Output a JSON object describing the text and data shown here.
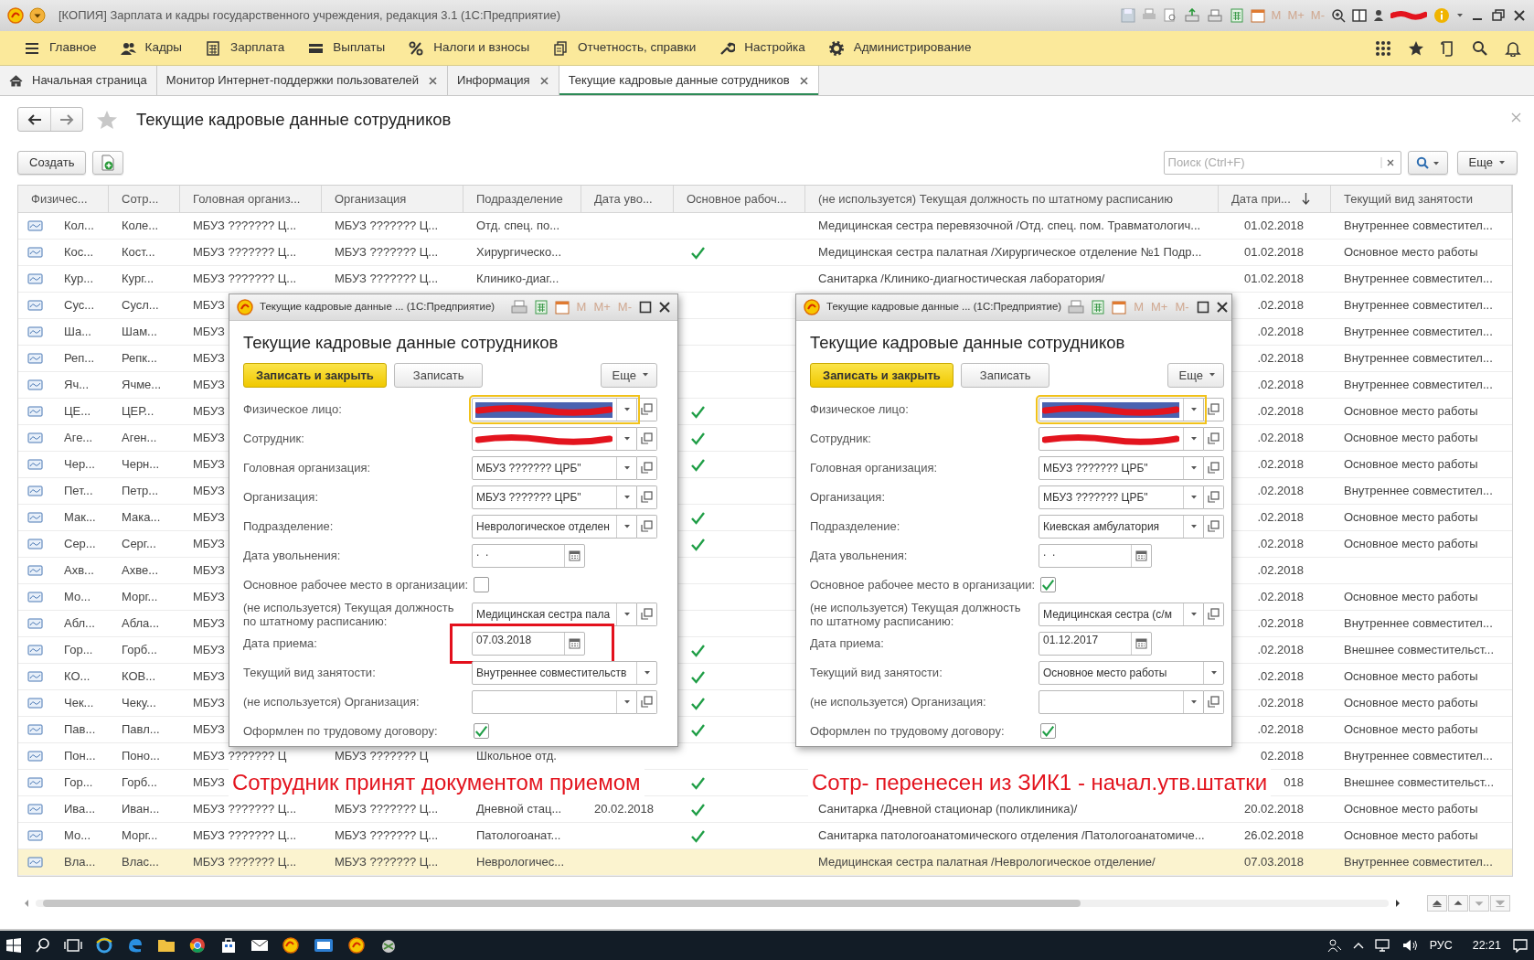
{
  "window": {
    "title": "[КОПИЯ] Зарплата и кадры государственного учреждения, редакция 3.1  (1С:Предприятие)",
    "memory_buttons": [
      "M",
      "M+",
      "M-"
    ]
  },
  "menu": [
    {
      "label": "Главное"
    },
    {
      "label": "Кадры"
    },
    {
      "label": "Зарплата"
    },
    {
      "label": "Выплаты"
    },
    {
      "label": "Налоги и взносы"
    },
    {
      "label": "Отчетность, справки"
    },
    {
      "label": "Настройка"
    },
    {
      "label": "Администрирование"
    }
  ],
  "tabs": [
    {
      "label": "Начальная страница",
      "selected": false,
      "closable": false
    },
    {
      "label": "Монитор Интернет-поддержки пользователей",
      "selected": false,
      "closable": true
    },
    {
      "label": "Информация",
      "selected": false,
      "closable": true
    },
    {
      "label": "Текущие кадровые данные сотрудников",
      "selected": true,
      "closable": true
    }
  ],
  "page": {
    "title": "Текущие кадровые данные сотрудников",
    "create_button": "Создать",
    "search_placeholder": "Поиск (Ctrl+F)",
    "more_button": "Еще"
  },
  "table": {
    "columns": [
      {
        "label": "Физичес...",
        "sorted": false
      },
      {
        "label": "Сотр...",
        "sorted": false
      },
      {
        "label": "Головная организ...",
        "sorted": false
      },
      {
        "label": "Организация",
        "sorted": false
      },
      {
        "label": "Подразделение",
        "sorted": false
      },
      {
        "label": "Дата уво...",
        "sorted": false
      },
      {
        "label": "Основное рабоч...",
        "sorted": false
      },
      {
        "label": "(не используется) Текущая должность по штатному расписанию",
        "sorted": false
      },
      {
        "label": "Дата при...",
        "sorted": true
      },
      {
        "label": "Текущий вид занятости",
        "sorted": false
      }
    ],
    "rows": [
      {
        "person": "Кол...",
        "employee": "Коле...",
        "head_org": "МБУЗ ??????? Ц...",
        "org": "МБУЗ ??????? Ц...",
        "department": "Отд. спец. по...",
        "main": false,
        "position": "Медицинская сестра перевязочной /Отд. спец. пом. Травматологич...",
        "hire_date": "01.02.2018",
        "employment": "Внутреннее совместител...",
        "selected": false
      },
      {
        "person": "Кос...",
        "employee": "Кост...",
        "head_org": "МБУЗ ??????? Ц...",
        "org": "МБУЗ ??????? Ц...",
        "department": "Хирургическо...",
        "main": true,
        "position": "Медицинская сестра палатная /Хирургическое отделение №1 Подр...",
        "hire_date": "01.02.2018",
        "employment": "Основное место работы",
        "selected": false
      },
      {
        "person": "Кур...",
        "employee": "Кург...",
        "head_org": "МБУЗ ??????? Ц...",
        "org": "МБУЗ ??????? Ц...",
        "department": "Клинико-диаг...",
        "main": false,
        "position": "Санитарка /Клинико-диагностическая лаборатория/",
        "hire_date": "01.02.2018",
        "employment": "Внутреннее совместител...",
        "selected": false
      },
      {
        "person": "Сус...",
        "employee": "Сусл...",
        "head_org": "МБУЗ",
        "main": false,
        "hire_date": ".02.2018",
        "employment": "Внутреннее совместител...",
        "selected": false
      },
      {
        "person": "Ша...",
        "employee": "Шам...",
        "head_org": "МБУЗ",
        "main": false,
        "hire_date": ".02.2018",
        "employment": "Внутреннее совместител...",
        "selected": false
      },
      {
        "person": "Реп...",
        "employee": "Репк...",
        "head_org": "МБУЗ",
        "main": false,
        "hire_date": ".02.2018",
        "employment": "Внутреннее совместител...",
        "selected": false
      },
      {
        "person": "Яч...",
        "employee": "Ячме...",
        "head_org": "МБУЗ",
        "main": false,
        "hire_date": ".02.2018",
        "employment": "Внутреннее совместител...",
        "selected": false
      },
      {
        "person": "ЦЕ...",
        "employee": "ЦЕР...",
        "head_org": "МБУЗ",
        "main": true,
        "hire_date": ".02.2018",
        "employment": "Основное место работы",
        "selected": false
      },
      {
        "person": "Аге...",
        "employee": "Аген...",
        "head_org": "МБУЗ",
        "main": true,
        "hire_date": ".02.2018",
        "employment": "Основное место работы",
        "selected": false
      },
      {
        "person": "Чер...",
        "employee": "Черн...",
        "head_org": "МБУЗ",
        "main": true,
        "hire_date": ".02.2018",
        "employment": "Основное место работы",
        "selected": false
      },
      {
        "person": "Пет...",
        "employee": "Петр...",
        "head_org": "МБУЗ",
        "main": false,
        "hire_date": ".02.2018",
        "employment": "Внутреннее совместител...",
        "selected": false
      },
      {
        "person": "Мак...",
        "employee": "Мака...",
        "head_org": "МБУЗ",
        "main": true,
        "hire_date": ".02.2018",
        "employment": "Основное место работы",
        "selected": false
      },
      {
        "person": "Сер...",
        "employee": "Серг...",
        "head_org": "МБУЗ",
        "main": true,
        "hire_date": ".02.2018",
        "employment": "Основное место работы",
        "selected": false
      },
      {
        "person": "Ахв...",
        "employee": "Ахве...",
        "head_org": "МБУЗ",
        "main": false,
        "hire_date": ".02.2018",
        "selected": false
      },
      {
        "person": "Мо...",
        "employee": "Морг...",
        "head_org": "МБУЗ",
        "main": false,
        "hire_date": ".02.2018",
        "employment": "Основное место работы",
        "selected": false
      },
      {
        "person": "Абл...",
        "employee": "Абла...",
        "head_org": "МБУЗ",
        "main": false,
        "hire_date": ".02.2018",
        "employment": "Внутреннее совместител...",
        "selected": false
      },
      {
        "person": "Гор...",
        "employee": "Горб...",
        "head_org": "МБУЗ",
        "main": true,
        "hire_date": ".02.2018",
        "employment": "Внешнее совместительст...",
        "selected": false
      },
      {
        "person": "КО...",
        "employee": "КОВ...",
        "head_org": "МБУЗ",
        "main": true,
        "hire_date": ".02.2018",
        "employment": "Основное место работы",
        "selected": false
      },
      {
        "person": "Чек...",
        "employee": "Чеку...",
        "head_org": "МБУЗ",
        "main": true,
        "hire_date": ".02.2018",
        "employment": "Основное место работы",
        "selected": false
      },
      {
        "person": "Пав...",
        "employee": "Павл...",
        "head_org": "МБУЗ",
        "main": true,
        "hire_date": ".02.2018",
        "employment": "Основное место работы",
        "selected": false
      },
      {
        "person": "Пон...",
        "employee": "Поно...",
        "head_org": "МБУЗ ??????? Ц",
        "org": "МБУЗ ??????? Ц",
        "department": "Школьное отд.",
        "main": false,
        "hire_date": "02.2018",
        "employment": "Внутреннее совместител...",
        "selected": false
      },
      {
        "person": "Гор...",
        "employee": "Горб...",
        "head_org": "МБУЗ",
        "main": true,
        "hire_date": "018",
        "employment": "Внешнее совместительст...",
        "selected": false
      },
      {
        "person": "Ива...",
        "employee": "Иван...",
        "head_org": "МБУЗ ??????? Ц...",
        "org": "МБУЗ ??????? Ц...",
        "department": "Дневной стац...",
        "dismissal": "20.02.2018",
        "main": true,
        "position": "Санитарка /Дневной стационар (поликлиника)/",
        "hire_date": "20.02.2018",
        "employment": "Основное место работы",
        "selected": false
      },
      {
        "person": "Мо...",
        "employee": "Морг...",
        "head_org": "МБУЗ ??????? Ц...",
        "org": "МБУЗ ??????? Ц...",
        "department": "Патологоанат...",
        "main": true,
        "position": "Санитарка патологоанатомического отделения /Патологоанатомиче...",
        "hire_date": "26.02.2018",
        "employment": "Основное место работы",
        "selected": false
      },
      {
        "person": "Вла...",
        "employee": "Влас...",
        "head_org": "МБУЗ ??????? Ц...",
        "org": "МБУЗ ??????? Ц...",
        "department": "Неврологичес...",
        "main": false,
        "position": "Медицинская сестра палатная /Неврологическое отделение/",
        "hire_date": "07.03.2018",
        "employment": "Внутреннее совместител...",
        "selected": true
      }
    ]
  },
  "dialogs": [
    {
      "window_title": "Текущие кадровые данные ... (1С:Предприятие)",
      "memory_buttons": [
        "M",
        "M+",
        "M-"
      ],
      "heading": "Текущие кадровые данные сотрудников",
      "buttons": [
        "Записать и закрыть",
        "Записать"
      ],
      "more_button": "Еще",
      "fields": [
        {
          "label": "Физическое лицо:",
          "kind": "select",
          "redacted": true,
          "focused": true
        },
        {
          "label": "Сотрудник:",
          "kind": "select",
          "redacted": true
        },
        {
          "label": "Головная организация:",
          "kind": "select",
          "value": "МБУЗ ??????? ЦРБ\""
        },
        {
          "label": "Организация:",
          "kind": "select",
          "value": "МБУЗ ??????? ЦРБ\""
        },
        {
          "label": "Подразделение:",
          "kind": "select",
          "value": "Неврологическое отделен"
        },
        {
          "label": "Дата увольнения:",
          "kind": "date",
          "value": ".  ."
        },
        {
          "label": "Основное рабочее место в организации:",
          "kind": "checkbox",
          "checked": false
        },
        {
          "label": "(не используется) Текущая должность по штатному расписанию:",
          "kind": "select",
          "value": "Медицинская сестра пала"
        },
        {
          "label": "Дата приема:",
          "kind": "date",
          "value": "07.03.2018",
          "highlighted": true
        },
        {
          "label": "Текущий вид занятости:",
          "kind": "select_only",
          "value": "Внутреннее совместительств"
        },
        {
          "label": "(не используется) Организация:",
          "kind": "select"
        },
        {
          "label": "Оформлен по трудовому договору:",
          "kind": "checkbox",
          "checked": true
        }
      ]
    },
    {
      "window_title": "Текущие кадровые данные ... (1С:Предприятие)",
      "memory_buttons": [
        "M",
        "M+",
        "M-"
      ],
      "heading": "Текущие кадровые данные сотрудников",
      "buttons": [
        "Записать и закрыть",
        "Записать"
      ],
      "more_button": "Еще",
      "fields": [
        {
          "label": "Физическое лицо:",
          "kind": "select",
          "redacted": true,
          "focused": true
        },
        {
          "label": "Сотрудник:",
          "kind": "select",
          "redacted": true
        },
        {
          "label": "Головная организация:",
          "kind": "select",
          "value": "МБУЗ ??????? ЦРБ\""
        },
        {
          "label": "Организация:",
          "kind": "select",
          "value": "МБУЗ ??????? ЦРБ\""
        },
        {
          "label": "Подразделение:",
          "kind": "select",
          "value": "Киевская амбулатория"
        },
        {
          "label": "Дата увольнения:",
          "kind": "date",
          "value": ".  ."
        },
        {
          "label": "Основное рабочее место в организации:",
          "kind": "checkbox",
          "checked": true
        },
        {
          "label": "(не используется) Текущая должность по штатному расписанию:",
          "kind": "select",
          "value": "Медицинская сестра (с/м"
        },
        {
          "label": "Дата приема:",
          "kind": "date",
          "value": "01.12.2017"
        },
        {
          "label": "Текущий вид занятости:",
          "kind": "select_only",
          "value": "Основное место работы"
        },
        {
          "label": "(не используется) Организация:",
          "kind": "select"
        },
        {
          "label": "Оформлен по трудовому договору:",
          "kind": "checkbox",
          "checked": true
        }
      ]
    }
  ],
  "annotations": [
    "Сотрудник принят документом приемом",
    "Сотр- перенесен из ЗИК1 - начал.утв.штатки"
  ],
  "taskbar": {
    "language": "РУС",
    "time": "22:21"
  }
}
